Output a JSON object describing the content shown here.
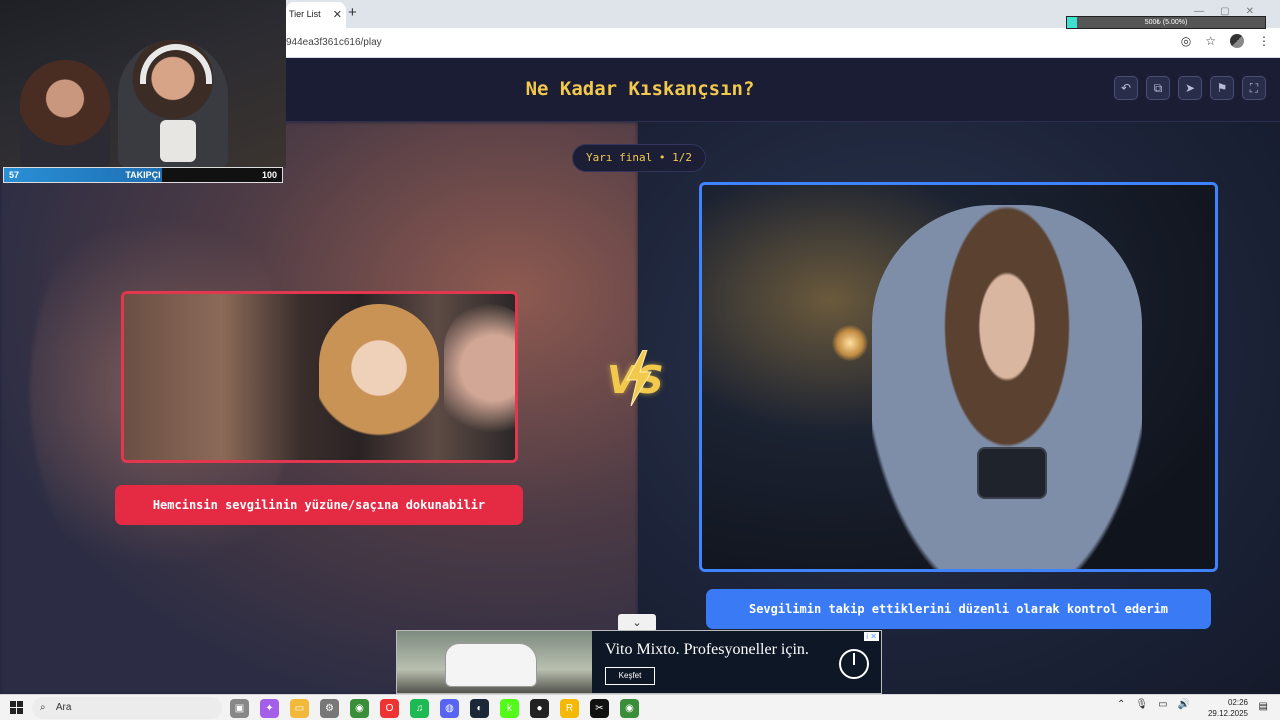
{
  "browser": {
    "tab_title": "Tier List",
    "tab_close": "✕",
    "new_tab": "+",
    "url": "944ea3f361c616/play"
  },
  "stream": {
    "donation_text": "500₺ (5.00%)",
    "donation_progress_pct": 5,
    "follower_min": "57",
    "follower_label": "TAKIPÇI",
    "follower_max": "100"
  },
  "game": {
    "title": "Ne Kadar Kıskançsın?",
    "round": "Yarı final • 1/2",
    "vs_label": "VS",
    "left_option": {
      "caption": "Hemcinsin sevgilinin yüzüne/saçına dokunabilir",
      "accent": "#e52a44"
    },
    "right_option": {
      "caption": "Sevgilimin takip ettiklerini düzenli olarak kontrol ederim",
      "accent": "#3a7bf5"
    },
    "toolbar": [
      "undo-icon",
      "copy-icon",
      "send-icon",
      "flag-icon",
      "fullscreen-icon"
    ]
  },
  "ad": {
    "headline": "Vito Mixto. Profesyoneller için.",
    "cta": "Keşfet",
    "brand_icon": "mercedes-star-icon"
  },
  "taskbar": {
    "search_placeholder": "Ara",
    "time": "02:26",
    "date": "29.12.2025"
  }
}
